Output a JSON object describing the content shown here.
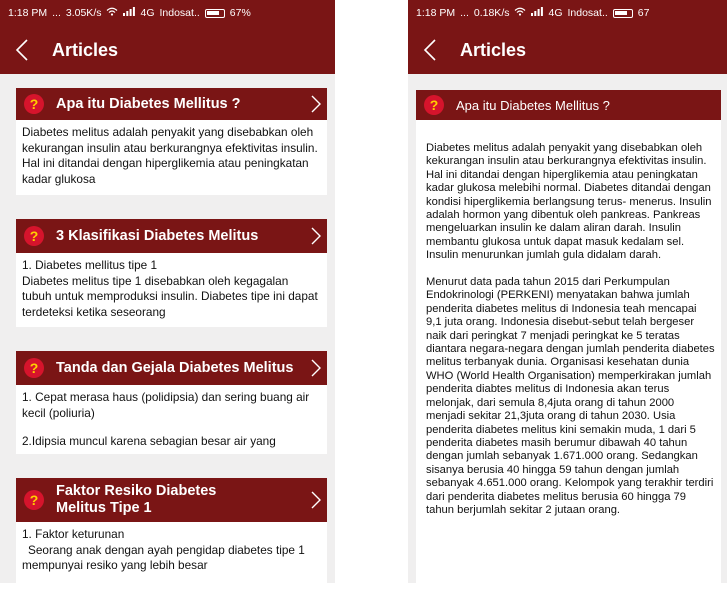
{
  "left": {
    "status": {
      "time": "1:18 PM",
      "dots": "...",
      "speed": "3.05K/s",
      "network": "4G",
      "carrier": "Indosat..",
      "battery": "67%"
    },
    "appbar": {
      "title": "Articles"
    },
    "cards": [
      {
        "title": "Apa itu Diabetes Mellitus ?",
        "body": "Diabetes melitus adalah penyakit yang disebabkan oleh kekurangan insulin atau berkurangnya efektivitas insulin. Hal ini ditandai dengan hiperglikemia atau peningkatan kadar glukosa"
      },
      {
        "title": "3 Klasifikasi Diabetes Melitus",
        "body_lines": [
          "1. Diabetes mellitus tipe 1",
          "Diabetes melitus tipe 1 disebabkan oleh kegagalan tubuh untuk memproduksi insulin. Diabetes tipe ini dapat terdeteksi ketika seseorang"
        ]
      },
      {
        "title": "Tanda dan Gejala Diabetes Melitus",
        "body_lines": [
          "1. Cepat merasa haus (polidipsia) dan sering buang air kecil (poliuria)",
          "2.Idipsia muncul karena sebagian besar air yang"
        ]
      },
      {
        "title": "Faktor Resiko Diabetes Melitus Tipe 1",
        "body_lines": [
          "1. Faktor keturunan",
          "Seorang anak dengan ayah pengidap diabetes tipe 1 mempunyai resiko yang lebih besar"
        ]
      }
    ]
  },
  "right": {
    "status": {
      "time": "1:18 PM",
      "dots": "...",
      "speed": "0.18K/s",
      "network": "4G",
      "carrier": "Indosat..",
      "battery": "67"
    },
    "appbar": {
      "title": "Articles"
    },
    "article": {
      "title": "Apa itu Diabetes Mellitus ?",
      "paragraphs": [
        "Diabetes melitus adalah penyakit yang disebabkan oleh kekurangan insulin atau berkurangnya efektivitas insulin. Hal ini ditandai dengan hiperglikemia atau peningkatan kadar glukosa melebihi normal. Diabetes ditandai dengan kondisi hiperglikemia berlangsung terus- menerus. Insulin adalah hormon yang dibentuk oleh pankreas. Pankreas mengeluarkan insulin ke dalam aliran darah. Insulin membantu glukosa untuk dapat masuk kedalam sel. Insulin menurunkan jumlah gula didalam darah.",
        "Menurut data pada tahun 2015 dari Perkumpulan Endokrinologi (PERKENI) menyatakan bahwa jumlah penderita diabetes melitus di Indonesia teah mencapai 9,1 juta orang. Indonesia disebut-sebut telah bergeser naik dari peringkat 7 menjadi peringkat ke 5 teratas diantara negara-negara dengan jumlah penderita diabetes melitus terbanyak dunia. Organisasi kesehatan dunia WHO (World Health Organisation) memperkirakan jumlah penderita diabtes melitus di Indonesia akan terus melonjak, dari semula 8,4juta orang di tahun 2000 menjadi sekitar 21,3juta orang di tahun 2030. Usia penderita diabetes melitus kini semakin muda, 1 dari 5 penderita diabetes masih berumur dibawah 40 tahun dengan jumlah sebanyak 1.671.000 orang. Sedangkan sisanya berusia 40 hingga 59 tahun dengan jumlah sebanyak 4.651.000 orang. Kelompok yang terakhir terdiri dari penderita diabetes melitus berusia 60 hingga 79 tahun berjumlah sekitar 2 jutaan orang."
      ]
    }
  },
  "colors": {
    "primary": "#7a1515",
    "icon_bg": "#d6142c",
    "icon_fg": "#ffd000",
    "page_bg": "#f0efef"
  },
  "icons": {
    "back": "chevron-left-icon",
    "more": "chevron-right-icon",
    "help": "question-mark-icon"
  }
}
